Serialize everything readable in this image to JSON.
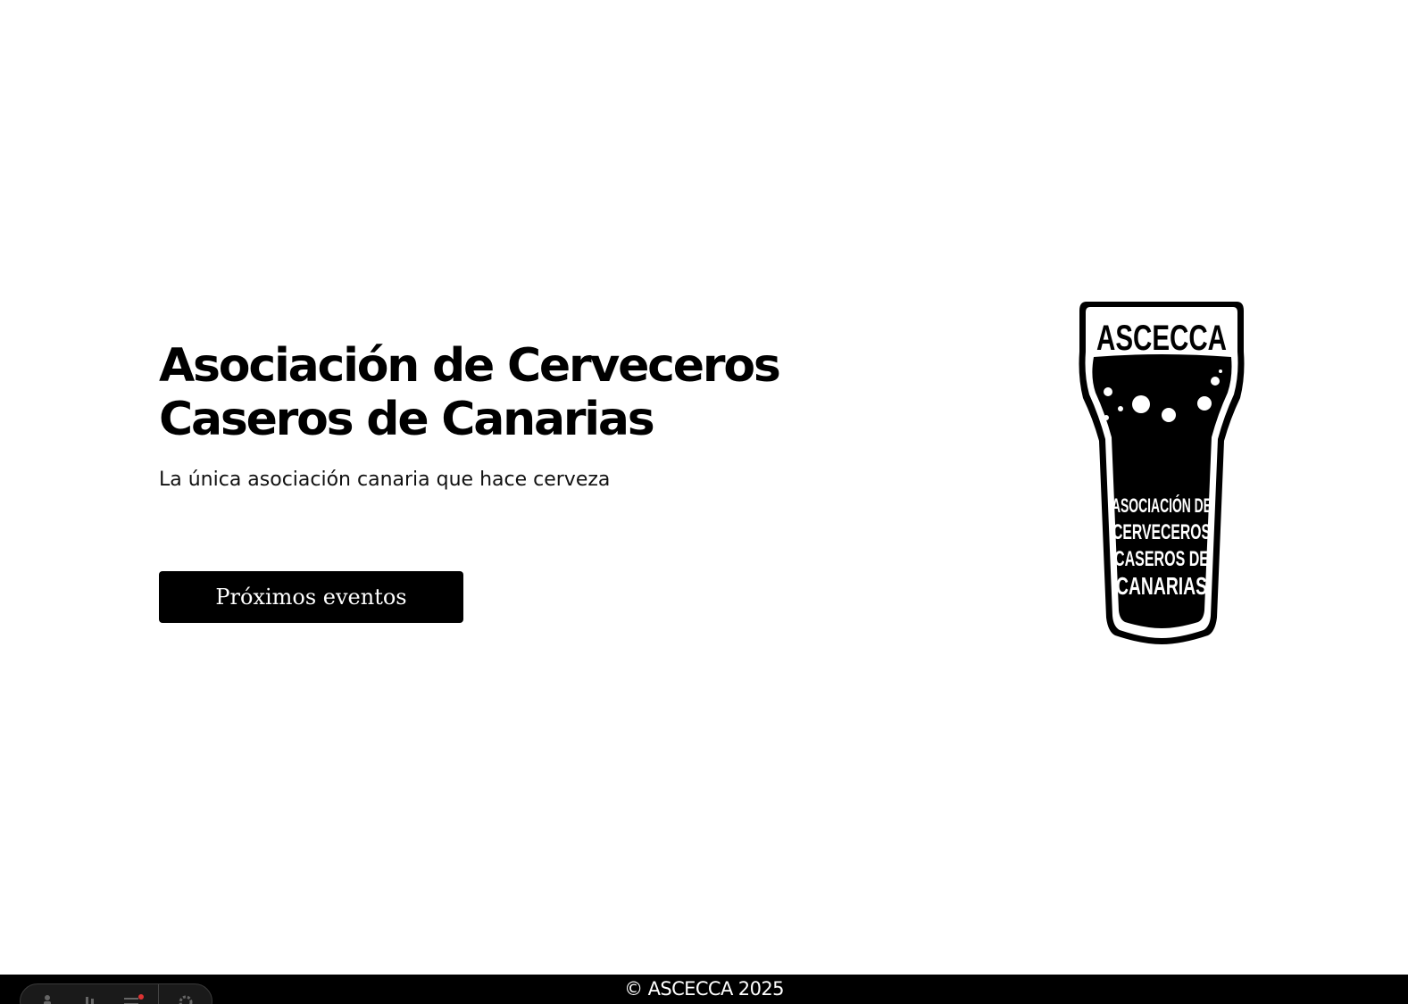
{
  "hero": {
    "title_line1": "Asociación de Cerveceros",
    "title_line2": "Caseros de Canarias",
    "subtitle": "La única asociación canaria que hace cerveza",
    "cta_label": "Próximos eventos"
  },
  "logo": {
    "top_text": "ASCECCA",
    "lines": [
      "ASOCIACIÓN DE",
      "CERVECEROS",
      "CASEROS DE",
      "CANARIAS"
    ]
  },
  "footer": {
    "text": "© ASCECCA 2025"
  },
  "toolbar": {
    "icons": [
      "accessibility-icon",
      "cheers-icon",
      "menu-icon",
      "settings-icon"
    ]
  },
  "colors": {
    "background": "#ffffff",
    "primary": "#000000",
    "on_primary": "#ffffff"
  }
}
